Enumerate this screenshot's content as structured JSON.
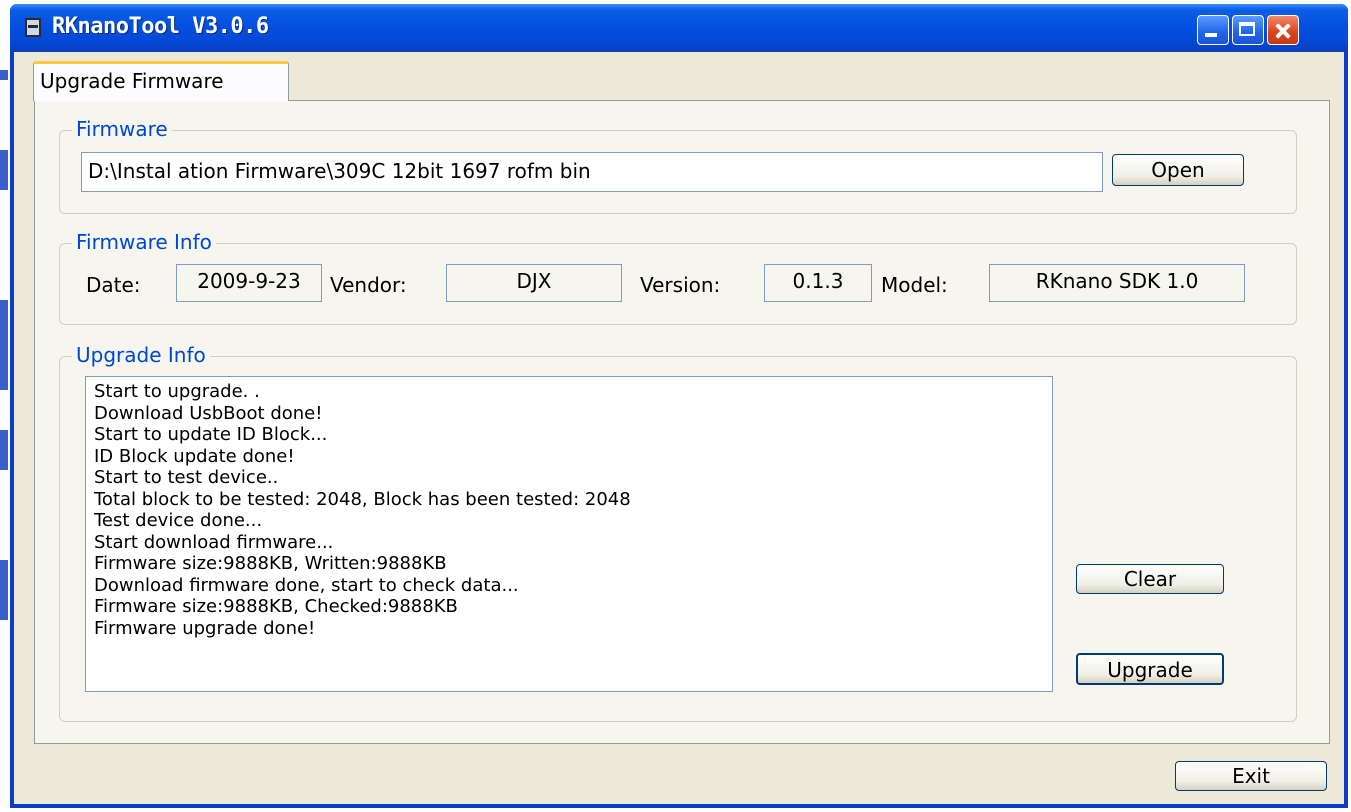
{
  "window": {
    "title": "RKnanoTool V3.0.6"
  },
  "tab": {
    "label": "Upgrade Firmware"
  },
  "firmware": {
    "group_label": "Firmware",
    "path": "D:\\Instal ation Firmware\\309C  12bit  1697  rofm bin",
    "open_label": "Open"
  },
  "firmware_info": {
    "group_label": "Firmware Info",
    "date_label": "Date:",
    "date_value": "2009-9-23",
    "vendor_label": "Vendor:",
    "vendor_value": "DJX",
    "version_label": "Version:",
    "version_value": "0.1.3",
    "model_label": "Model:",
    "model_value": "RKnano SDK 1.0"
  },
  "upgrade_info": {
    "group_label": "Upgrade Info",
    "log": [
      "Start to upgrade. .",
      "Download UsbBoot done!",
      "Start to update ID Block...",
      "ID Block update done!",
      "Start to test device..",
      "Total block to be tested: 2048, Block has been tested: 2048",
      "Test device done...",
      "Start download firmware...",
      "Firmware size:9888KB, Written:9888KB",
      "Download firmware done, start to check data...",
      "Firmware size:9888KB, Checked:9888KB",
      "Firmware upgrade done!"
    ],
    "clear_label": "Clear",
    "upgrade_label": "Upgrade"
  },
  "exit_label": "Exit"
}
